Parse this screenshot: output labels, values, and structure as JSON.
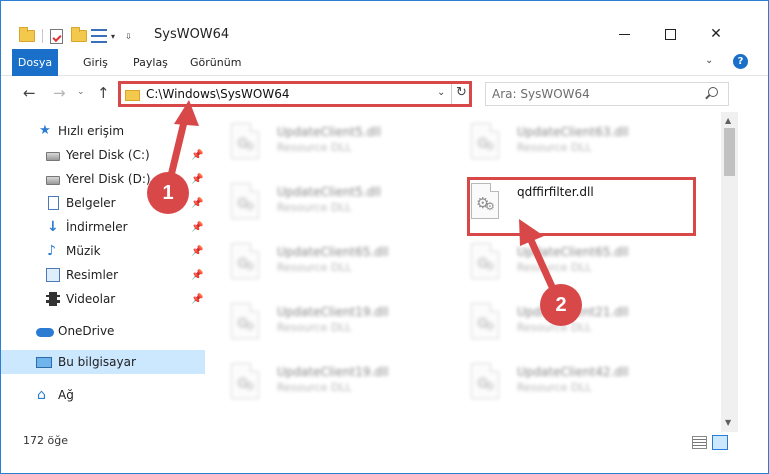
{
  "window": {
    "title": "SysWOW64",
    "minimize_glyph": "",
    "close_glyph": "✕"
  },
  "ribbon": {
    "tabs": [
      "Dosya",
      "Giriş",
      "Paylaş",
      "Görünüm"
    ],
    "expand_glyph": "⌄",
    "help_glyph": "?"
  },
  "navigation": {
    "back_glyph": "←",
    "forward_glyph": "→",
    "recent_glyph": "⌄",
    "up_glyph": "↑",
    "address_path": "C:\\Windows\\SysWOW64",
    "address_chevron": "⌄",
    "refresh_glyph": "↻",
    "search_placeholder": "Ara: SysWOW64"
  },
  "sidebar": {
    "items": [
      {
        "label": "Hızlı erişim",
        "icon": "star-icon"
      },
      {
        "label": "Yerel Disk (C:)",
        "icon": "drive-icon",
        "pin": "📌"
      },
      {
        "label": "Yerel Disk (D:)",
        "icon": "drive-icon",
        "pin": "📌"
      },
      {
        "label": "Belgeler",
        "icon": "document-icon",
        "pin": "📌"
      },
      {
        "label": "İndirmeler",
        "icon": "download-icon",
        "pin": "📌"
      },
      {
        "label": "Müzik",
        "icon": "music-icon",
        "pin": "📌"
      },
      {
        "label": "Resimler",
        "icon": "pictures-icon",
        "pin": "📌"
      },
      {
        "label": "Videolar",
        "icon": "videos-icon",
        "pin": "📌"
      },
      {
        "label": "OneDrive",
        "icon": "cloud-icon"
      },
      {
        "label": "Bu bilgisayar",
        "icon": "computer-icon"
      },
      {
        "label": "Ağ",
        "icon": "network-icon"
      }
    ]
  },
  "files": [
    {
      "name": "UpdateClient5.dll",
      "type": "Resource DLL"
    },
    {
      "name": "UpdateClient63.dll",
      "type": "Resource DLL"
    },
    {
      "name": "UpdateClient5.dll",
      "type": "Resource DLL"
    },
    {
      "name": "qdffirfilter.dll",
      "type": ""
    },
    {
      "name": "UpdateClient65.dll",
      "type": "Resource DLL"
    },
    {
      "name": "UpdateClient65.dll",
      "type": "Resource DLL"
    },
    {
      "name": "UpdateClient19.dll",
      "type": "Resource DLL"
    },
    {
      "name": "UpdateClient21.dll",
      "type": "Resource DLL"
    },
    {
      "name": "UpdateClient19.dll",
      "type": "Resource DLL"
    },
    {
      "name": "UpdateClient42.dll",
      "type": "Resource DLL"
    }
  ],
  "status": {
    "item_count": "172 öğe"
  },
  "annotations": {
    "badge_1": "1",
    "badge_2": "2"
  },
  "colors": {
    "accent": "#1a6fc9",
    "highlight_red": "#d94848",
    "selection": "#cce8ff"
  }
}
